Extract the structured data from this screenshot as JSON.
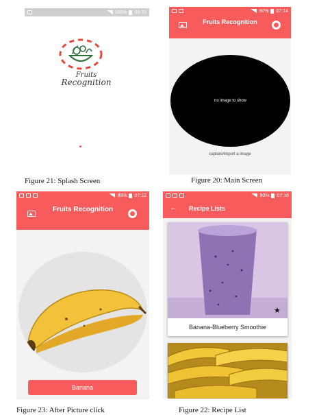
{
  "splash": {
    "status_time": "09:15",
    "status_battery": "100%",
    "logo_line1": "Fruits",
    "logo_line2": "Recognition",
    "caption": "Figure 21: Splash Screen"
  },
  "main_screen": {
    "status_time": "07:14",
    "status_battery": "90%",
    "title": "Fruits Recognition",
    "placeholder_text": "no image to show",
    "capture_text": "capture/import a image",
    "caption": "Figure 20: Main Screen"
  },
  "after_click": {
    "status_time": "07:22",
    "status_battery": "89%",
    "title": "Fruits Recognition",
    "result_button": "Banana",
    "caption": "Figure 23: After Picture click"
  },
  "recipe_list": {
    "status_time": "07:16",
    "status_battery": "90%",
    "title": "Recipe Lists",
    "items": [
      {
        "name": "Banana-Blueberry Smoothie"
      }
    ],
    "caption": "Figure 22: Recipe List"
  },
  "colors": {
    "accent": "#f75b5b",
    "status_grey": "#cfcfcf",
    "preview_black": "#000000"
  },
  "icons": [
    "image-icon",
    "camera-icon",
    "back-arrow-icon",
    "star-icon",
    "fruit-basket-logo-icon"
  ]
}
